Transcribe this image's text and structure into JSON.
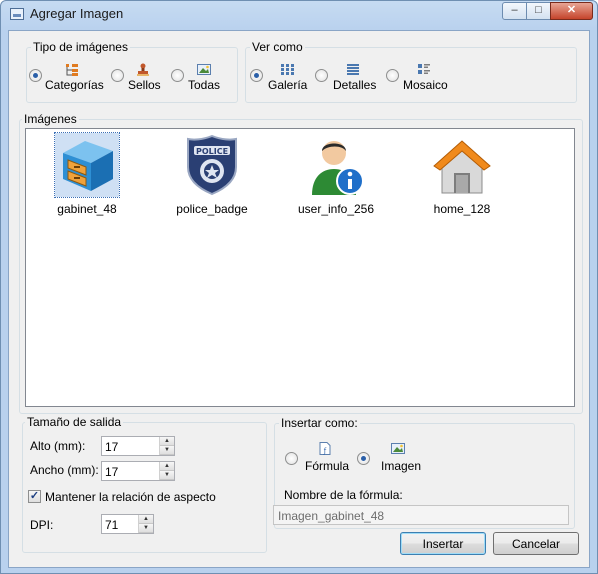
{
  "window": {
    "title": "Agregar Imagen",
    "controls": {
      "minimize": "–",
      "maximize": "□",
      "close": "✕"
    }
  },
  "tipo": {
    "legend": "Tipo de imágenes",
    "options": [
      {
        "label": "Categorías",
        "selected": true,
        "icon": "categories-icon"
      },
      {
        "label": "Sellos",
        "selected": false,
        "icon": "stamp-icon"
      },
      {
        "label": "Todas",
        "selected": false,
        "icon": "picture-icon"
      }
    ]
  },
  "ver": {
    "legend": "Ver como",
    "options": [
      {
        "label": "Galería",
        "selected": true,
        "icon": "gallery-view-icon"
      },
      {
        "label": "Detalles",
        "selected": false,
        "icon": "details-view-icon"
      },
      {
        "label": "Mosaico",
        "selected": false,
        "icon": "tile-view-icon"
      }
    ]
  },
  "imagenes": {
    "legend": "Imágenes",
    "items": [
      {
        "label": "gabinet_48",
        "icon": "cabinet-icon",
        "selected": true
      },
      {
        "label": "police_badge",
        "icon": "police-badge-icon",
        "selected": false
      },
      {
        "label": "user_info_256",
        "icon": "user-info-icon",
        "selected": false
      },
      {
        "label": "home_128",
        "icon": "home-icon",
        "selected": false
      }
    ]
  },
  "tamano": {
    "legend": "Tamaño de salida",
    "alto_label": "Alto (mm):",
    "alto_value": "17",
    "ancho_label": "Ancho (mm):",
    "ancho_value": "17",
    "aspect_label": "Mantener la relación de aspecto",
    "aspect_checked": true,
    "dpi_label": "DPI:",
    "dpi_value": "71"
  },
  "insertar_como": {
    "legend": "Insertar como:",
    "options": [
      {
        "label": "Fórmula",
        "selected": false,
        "icon": "formula-icon"
      },
      {
        "label": "Imagen",
        "selected": true,
        "icon": "image-icon"
      }
    ],
    "nombre_label": "Nombre de la fórmula:",
    "nombre_value": "Imagen_gabinet_48"
  },
  "buttons": {
    "insert": "Insertar",
    "cancel": "Cancelar"
  },
  "colors": {
    "accent": "#2a5fa8",
    "title_bar": "#b9d1ee",
    "close_button": "#c5442b"
  }
}
